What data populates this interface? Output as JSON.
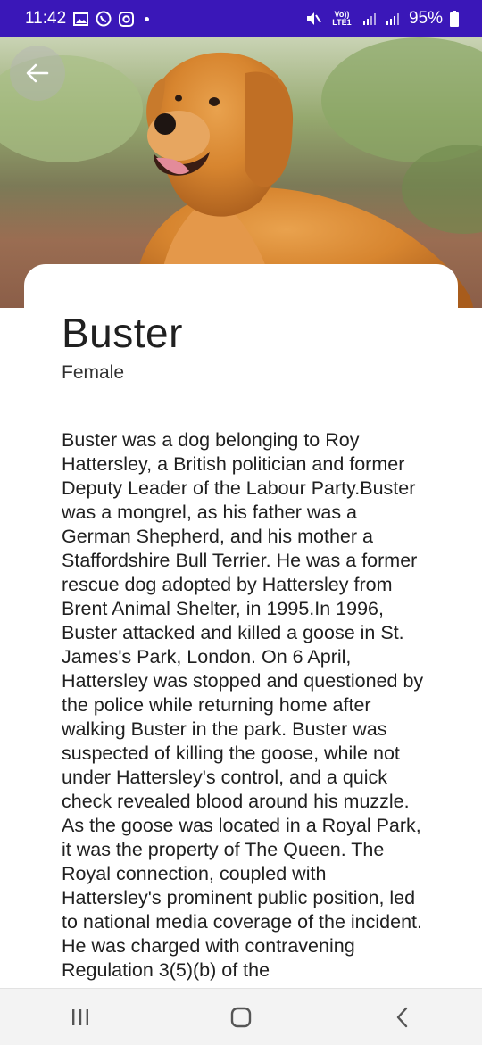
{
  "status_bar": {
    "time": "11:42",
    "network": "LTE",
    "volte": "Vo)) LTE1",
    "battery": "95%"
  },
  "hero": {
    "image": "golden-retriever-photo",
    "back_icon": "arrow-left-icon"
  },
  "pet": {
    "name": "Buster",
    "gender": "Female",
    "description": "Buster was a dog belonging to Roy Hattersley, a British politician and former Deputy Leader of the Labour Party.Buster was a mongrel, as his father was a German Shepherd, and his mother a Staffordshire Bull Terrier. He was a former rescue dog adopted by Hattersley from Brent Animal Shelter, in 1995.In 1996, Buster attacked and killed a goose in St. James's Park, London. On 6 April, Hattersley was stopped and questioned by the police while returning home after walking Buster in the park. Buster was suspected of killing the goose, while not under Hattersley's control, and a quick check revealed blood around his muzzle. As the goose was located in a Royal Park, it was the property of The Queen. The Royal connection, coupled with Hattersley's prominent public position, led to national media coverage of the incident. He was charged with contravening Regulation 3(5)(b) of the"
  },
  "nav_bar": {
    "recents_icon": "recents-icon",
    "home_icon": "home-icon",
    "back_icon": "back-chevron-icon"
  },
  "colors": {
    "status_bar": "#3a17b8",
    "nav_bar": "#f3f3f3",
    "text": "#202020"
  }
}
